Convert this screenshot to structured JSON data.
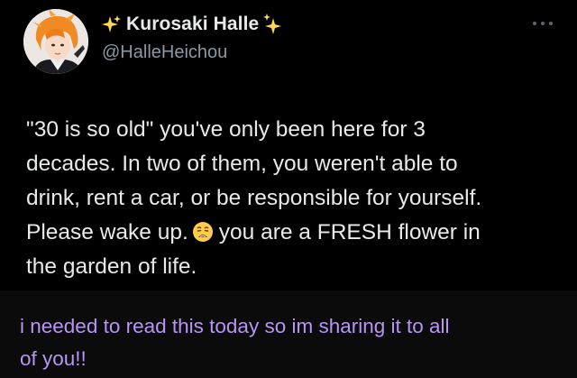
{
  "tweet": {
    "display_name": "Kurosaki Halle",
    "handle": "@HalleHeichou",
    "name_decoration_icon": "sparkles-icon",
    "more_icon": "more-options-icon",
    "avatar_icon": "profile-avatar",
    "text_lines": {
      "l1": "\"30 is so old\" you've only been here for 3",
      "l2": "decades. In two of them, you weren't able to",
      "l3": "drink, rent a car, or be responsible for yourself.",
      "l4a": "Please wake up.",
      "l4b": "you are a FRESH flower in",
      "l5": "the garden of life."
    },
    "emoji_icon": "weary-face-emoji"
  },
  "caption": {
    "lines": {
      "l1": "i needed to read this today so im sharing it to all",
      "l2": "of you!!"
    },
    "color": "#b794f6"
  }
}
